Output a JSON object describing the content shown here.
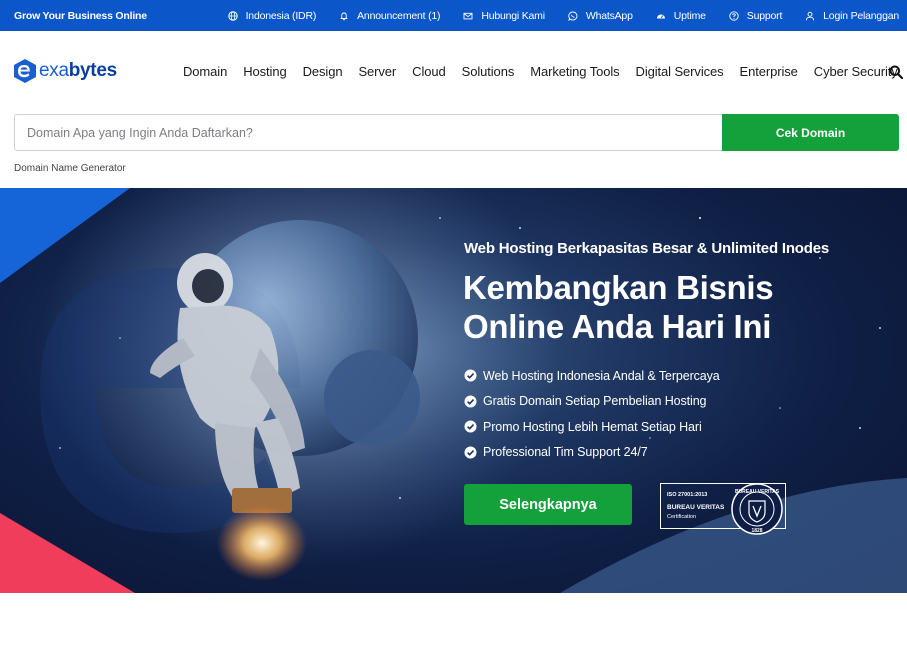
{
  "topbar": {
    "tagline": "Grow Your Business Online",
    "links": [
      {
        "label": "Indonesia (IDR)",
        "icon": "globe-icon"
      },
      {
        "label": "Announcement (1)",
        "icon": "bell-icon"
      },
      {
        "label": "Hubungi Kami",
        "icon": "mail-icon"
      },
      {
        "label": "WhatsApp",
        "icon": "whatsapp-icon"
      },
      {
        "label": "Uptime",
        "icon": "speedometer-icon"
      },
      {
        "label": "Support",
        "icon": "question-circle-icon"
      },
      {
        "label": "Login Pelanggan",
        "icon": "user-icon"
      }
    ],
    "color": "#0b57c9"
  },
  "logo": {
    "part1": "exa",
    "part2": "bytes"
  },
  "nav": {
    "items": [
      "Domain",
      "Hosting",
      "Design",
      "Server",
      "Cloud",
      "Solutions",
      "Marketing Tools",
      "Digital Services",
      "Enterprise",
      "Cyber Security"
    ],
    "search_icon": "search-icon"
  },
  "domain_search": {
    "placeholder": "Domain Apa yang Ingin Anda Daftarkan?",
    "button_label": "Cek Domain",
    "generator_link": "Domain Name Generator",
    "button_color": "#14a13b"
  },
  "hero": {
    "headline": "Web Hosting Berkapasitas Besar & Unlimited Inodes",
    "title_line1": "Kembangkan Bisnis",
    "title_line2": "Online Anda Hari Ini",
    "features": [
      "Web Hosting Indonesia Andal & Terpercaya",
      "Gratis Domain Setiap Pembelian Hosting",
      "Promo Hosting Lebih Hemat Setiap Hari",
      "Professional Tim Support 24/7"
    ],
    "cta_label": "Selengkapnya",
    "cert": {
      "line1": "ISO 27001:2013",
      "line2": "BUREAU VERITAS",
      "line3": "Certification",
      "seal_text": "BUREAU VERITAS",
      "seal_year": "1828"
    }
  }
}
